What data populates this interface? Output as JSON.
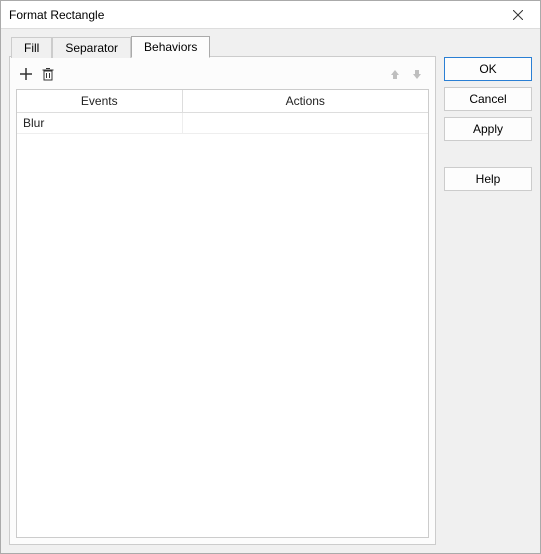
{
  "window": {
    "title": "Format Rectangle"
  },
  "tabs": [
    {
      "label": "Fill",
      "active": false
    },
    {
      "label": "Separator",
      "active": false
    },
    {
      "label": "Behaviors",
      "active": true
    }
  ],
  "toolbar": {
    "add_icon": "plus-icon",
    "delete_icon": "trash-icon",
    "move_up_icon": "arrow-up-icon",
    "move_down_icon": "arrow-down-icon",
    "move_up_enabled": false,
    "move_down_enabled": false
  },
  "table": {
    "headers": {
      "events": "Events",
      "actions": "Actions"
    },
    "rows": [
      {
        "event": "Blur",
        "action": ""
      }
    ]
  },
  "buttons": {
    "ok": "OK",
    "cancel": "Cancel",
    "apply": "Apply",
    "help": "Help"
  }
}
